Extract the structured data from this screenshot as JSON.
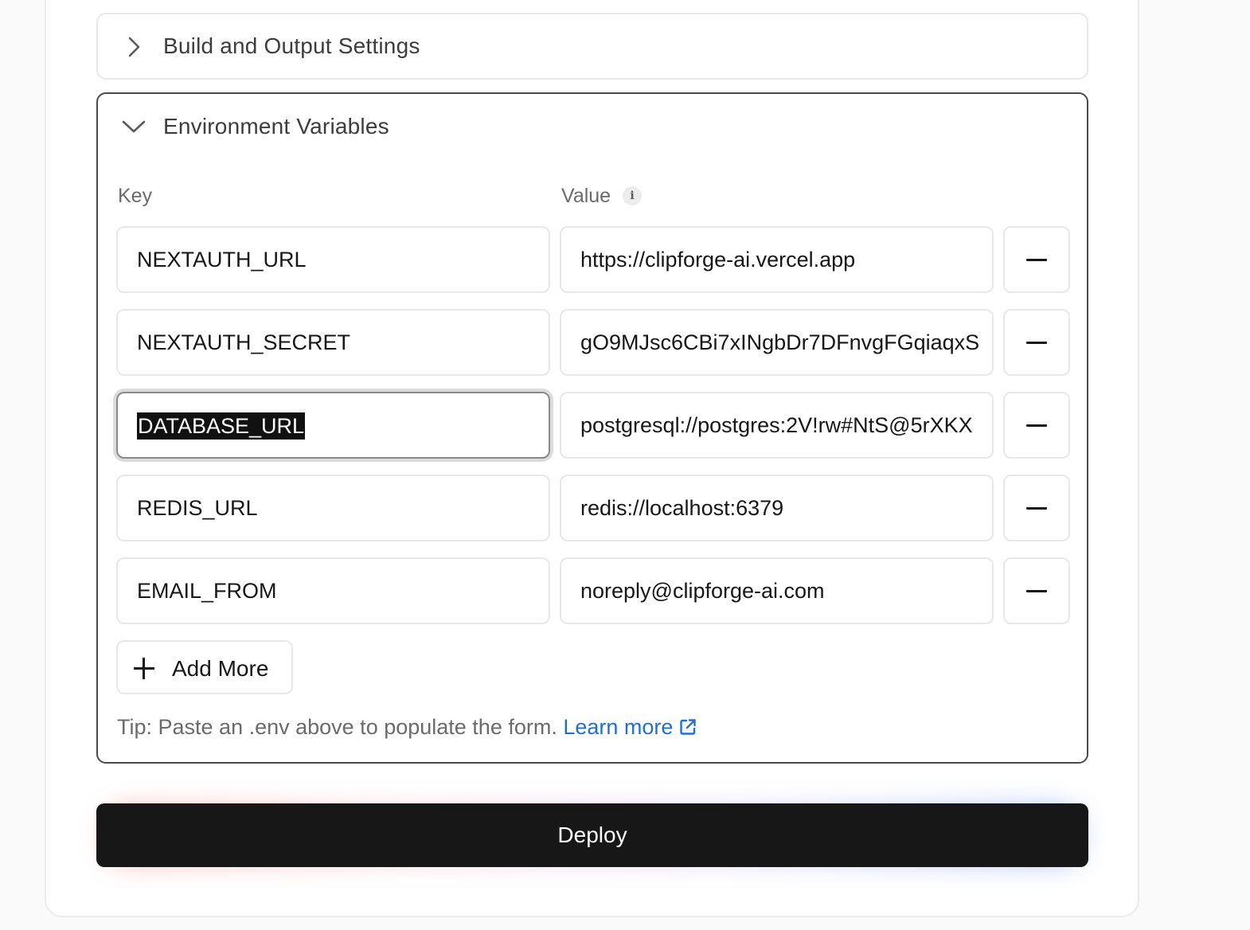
{
  "build_section": {
    "title": "Build and Output Settings",
    "expanded": false
  },
  "env_section": {
    "title": "Environment Variables",
    "expanded": true,
    "key_label": "Key",
    "value_label": "Value",
    "rows": [
      {
        "key": "NEXTAUTH_URL",
        "value": "https://clipforge-ai.vercel.app"
      },
      {
        "key": "NEXTAUTH_SECRET",
        "value": "gO9MJsc6CBi7xINgbDr7DFnvgFGqiaqxS"
      },
      {
        "key": "DATABASE_URL",
        "value": "postgresql://postgres:2V!rw#NtS@5rXKX"
      },
      {
        "key": "REDIS_URL",
        "value": "redis://localhost:6379"
      },
      {
        "key": "EMAIL_FROM",
        "value": "noreply@clipforge-ai.com"
      }
    ],
    "focused_row": 2,
    "add_more_label": "Add More",
    "tip_text": "Tip: Paste an .env above to populate the form.",
    "learn_more_label": "Learn more"
  },
  "deploy_label": "Deploy",
  "colors": {
    "accent_link": "#1f6fd6",
    "deploy_bg": "#171717",
    "glow_left": "#ff6b6b",
    "glow_right": "#4f7bff"
  },
  "icons": {
    "collapsed_chevron": "chevron-right-icon",
    "expanded_chevron": "chevron-down-icon",
    "info": "info-icon",
    "remove": "minus-icon",
    "add": "plus-icon",
    "external": "external-link-icon"
  }
}
